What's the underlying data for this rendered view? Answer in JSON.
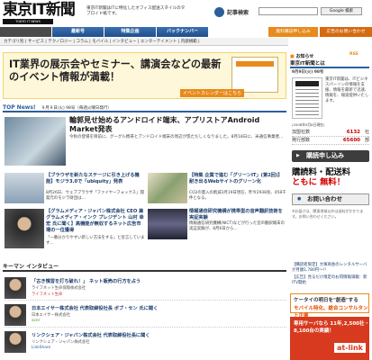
{
  "header": {
    "logo": "東京IT新聞",
    "logo_sub": "TOKYO IT NEWS",
    "tagline": "東京IT新聞はITに特化したオフィス配送スタイルのタブロイド紙です。",
    "search_label": "記事検索",
    "search_placeholder": "",
    "search_button": "Google 検索"
  },
  "nav": {
    "tabs": [
      "最新号",
      "最新号",
      "特集企画",
      "バックナンバー"
    ],
    "right_tabs": [
      "無料購読申し込み",
      "広告のお問い合わせ"
    ]
  },
  "subnav": "カテゴリ別 | サービス | テクノロジー | コラム | モバイル | インタビュー | エンターテイメント | 内部規範 |",
  "banner": {
    "text": "IT業界の展示会やセミナー、講演会などの最新のイベント情報が満載！",
    "link": "イベントカレンダーはこちら"
  },
  "top_news": {
    "label": "TOP News!",
    "date": "９月９日(火) 98号（毎週火曜日発行）",
    "lead_title": "輪郭見せ始めるアンドロイド端末、アプリストアAndroid Market発表",
    "lead_body": "今秋の登場を目前に、グーグル携帯とアンドロイド端末の周辺が慌ただしくなりました。8月18日に、米通信事業者…"
  },
  "cards": [
    {
      "title": "【ブラウザを新たなステージに引き上げる機能】モジラ3.0で「ubiquity」発表",
      "body": "8月26日、ウェブブラウザ「ファイヤーフォックス」開発元のモジラ財団は…"
    },
    {
      "title": "【特集 企業で進む「グリーンIT」(第2回)】耐き出るWebサイトのグリーン化",
      "body": "CO2の量入の削減3月19日現在、昨今2938兆、458千件となる。"
    },
    {
      "title": "【グラムメディア・ジャパン株式会社 CEO 兼 グラムメディア・インク プレジデント 山村 幸宏 氏に聞く】高機能が無収するネット広告市場の一位獲得",
      "body": "「一番分かりやすい新しい方法をする」と宣言しています…"
    },
    {
      "title": "情報通信研究機構が携帯型の音声翻訳技術を実証実験",
      "body": "情報通信研究機構(NICT)などが行った音声翻訳端末の実証実験が、8月6日から…"
    }
  ],
  "interview": {
    "label": "キーマン インタビュー",
    "rows": [
      {
        "title": "「古き慣習を打ち破れ！」 ネット販売の行方を占う",
        "sub": "ライフネット生命保険株式会社",
        "logo": "ライフネット生命"
      },
      {
        "title": "日本エイサー株式会社 代表取締役社長 ボブ・セン 氏に聞く",
        "sub": "日本エイサー株式会社",
        "logo": "acer"
      },
      {
        "title": "リンクシェア・ジャパン株式会社 代表取締役社長に聞く",
        "sub": "リンクシェア・ジャパン株式会社",
        "logo": "LinkShare"
      }
    ]
  },
  "sidebar": {
    "osusume": "お知らせ",
    "about_head": "東京IT新聞とは",
    "about_date": "9月9日(火) 98号",
    "about_text": "東京IT新聞は、ITビジネスパーソンの情報を支援、情報を最新で迅速、情報を、報道提供いたします。",
    "stats_date": "(2008年9月8日現在)",
    "stats": [
      {
        "label": "加盟社数",
        "value": "6132",
        "unit": "社"
      },
      {
        "label": "発行部数",
        "value": "65600",
        "unit": "部"
      }
    ],
    "subscribe": "購読申し込み",
    "promo_line1": "購読料・配送料",
    "promo_line2": "ともに 無料！",
    "contact": "お問い合わせ",
    "small_text": "※お届けは、関東地域以外は送料がかかります。お問い合わせください。",
    "news_list": "【購読者限定】大塚商会のレンタルサーバが月額1,780円〜!!",
    "news_list2": "【広告】見るだけ限定のお得情報満載：新ITV開始",
    "ad1_line1": "ケータイの明日を\"創造\"する",
    "ad1_line2": "モバイル特化、総合コンサルタント企業",
    "ad2_line": "専用サーバなら 11年,2,500社・8,100台の実績！",
    "ad2_logo": "at-link"
  },
  "colors": {
    "nav_blue": "#2a5f9a",
    "accent_orange": "#e88a1c",
    "promo_red": "#d40000"
  }
}
